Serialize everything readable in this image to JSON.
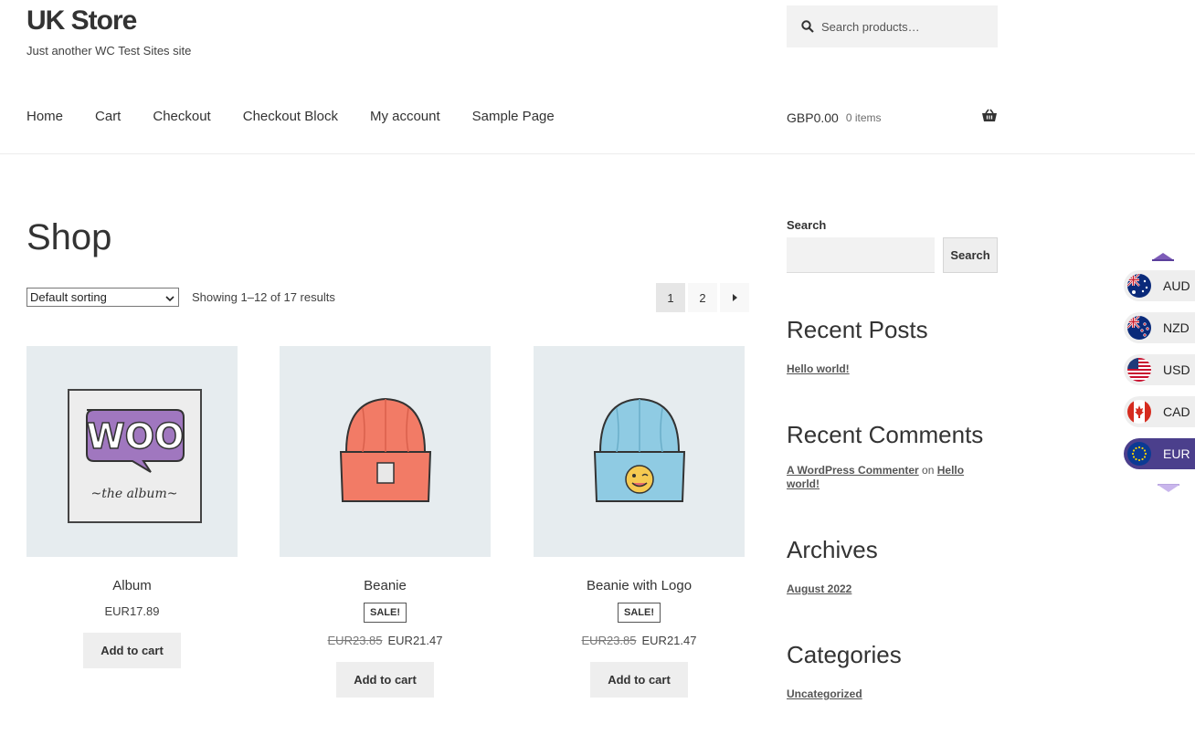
{
  "site": {
    "title": "UK Store",
    "description": "Just another WC Test Sites site"
  },
  "header_search": {
    "placeholder": "Search products…",
    "icon": "search-icon"
  },
  "nav": {
    "items": [
      "Home",
      "Cart",
      "Checkout",
      "Checkout Block",
      "My account",
      "Sample Page"
    ]
  },
  "mini_cart": {
    "amount": "GBP0.00",
    "count": "0 items",
    "icon": "basket-icon"
  },
  "shop": {
    "title": "Shop",
    "sorting": "Default sorting",
    "result_count": "Showing 1–12 of 17 results",
    "pagination": [
      "1",
      "2"
    ]
  },
  "products": [
    {
      "name": "Album",
      "price": "EUR17.89",
      "sale": false,
      "button": "Add to cart"
    },
    {
      "name": "Beanie",
      "sale_badge": "SALE!",
      "old_price": "EUR23.85",
      "price": "EUR21.47",
      "sale": true,
      "button": "Add to cart"
    },
    {
      "name": "Beanie with Logo",
      "sale_badge": "SALE!",
      "old_price": "EUR23.85",
      "price": "EUR21.47",
      "sale": true,
      "button": "Add to cart"
    }
  ],
  "sidebar": {
    "search_label": "Search",
    "search_button": "Search",
    "recent_posts_title": "Recent Posts",
    "recent_posts": [
      "Hello world!"
    ],
    "recent_comments_title": "Recent Comments",
    "comment_author": "A WordPress Commenter",
    "comment_on": "on",
    "comment_post": "Hello world!",
    "archives_title": "Archives",
    "archives": [
      "August 2022"
    ],
    "categories_title": "Categories",
    "categories": [
      "Uncategorized"
    ]
  },
  "currencies": [
    {
      "code": "AUD",
      "active": false
    },
    {
      "code": "NZD",
      "active": false
    },
    {
      "code": "USD",
      "active": false
    },
    {
      "code": "CAD",
      "active": false
    },
    {
      "code": "EUR",
      "active": true
    }
  ],
  "colors": {
    "accent": "#4b3f8c",
    "arrow": "#7d5cb8"
  }
}
